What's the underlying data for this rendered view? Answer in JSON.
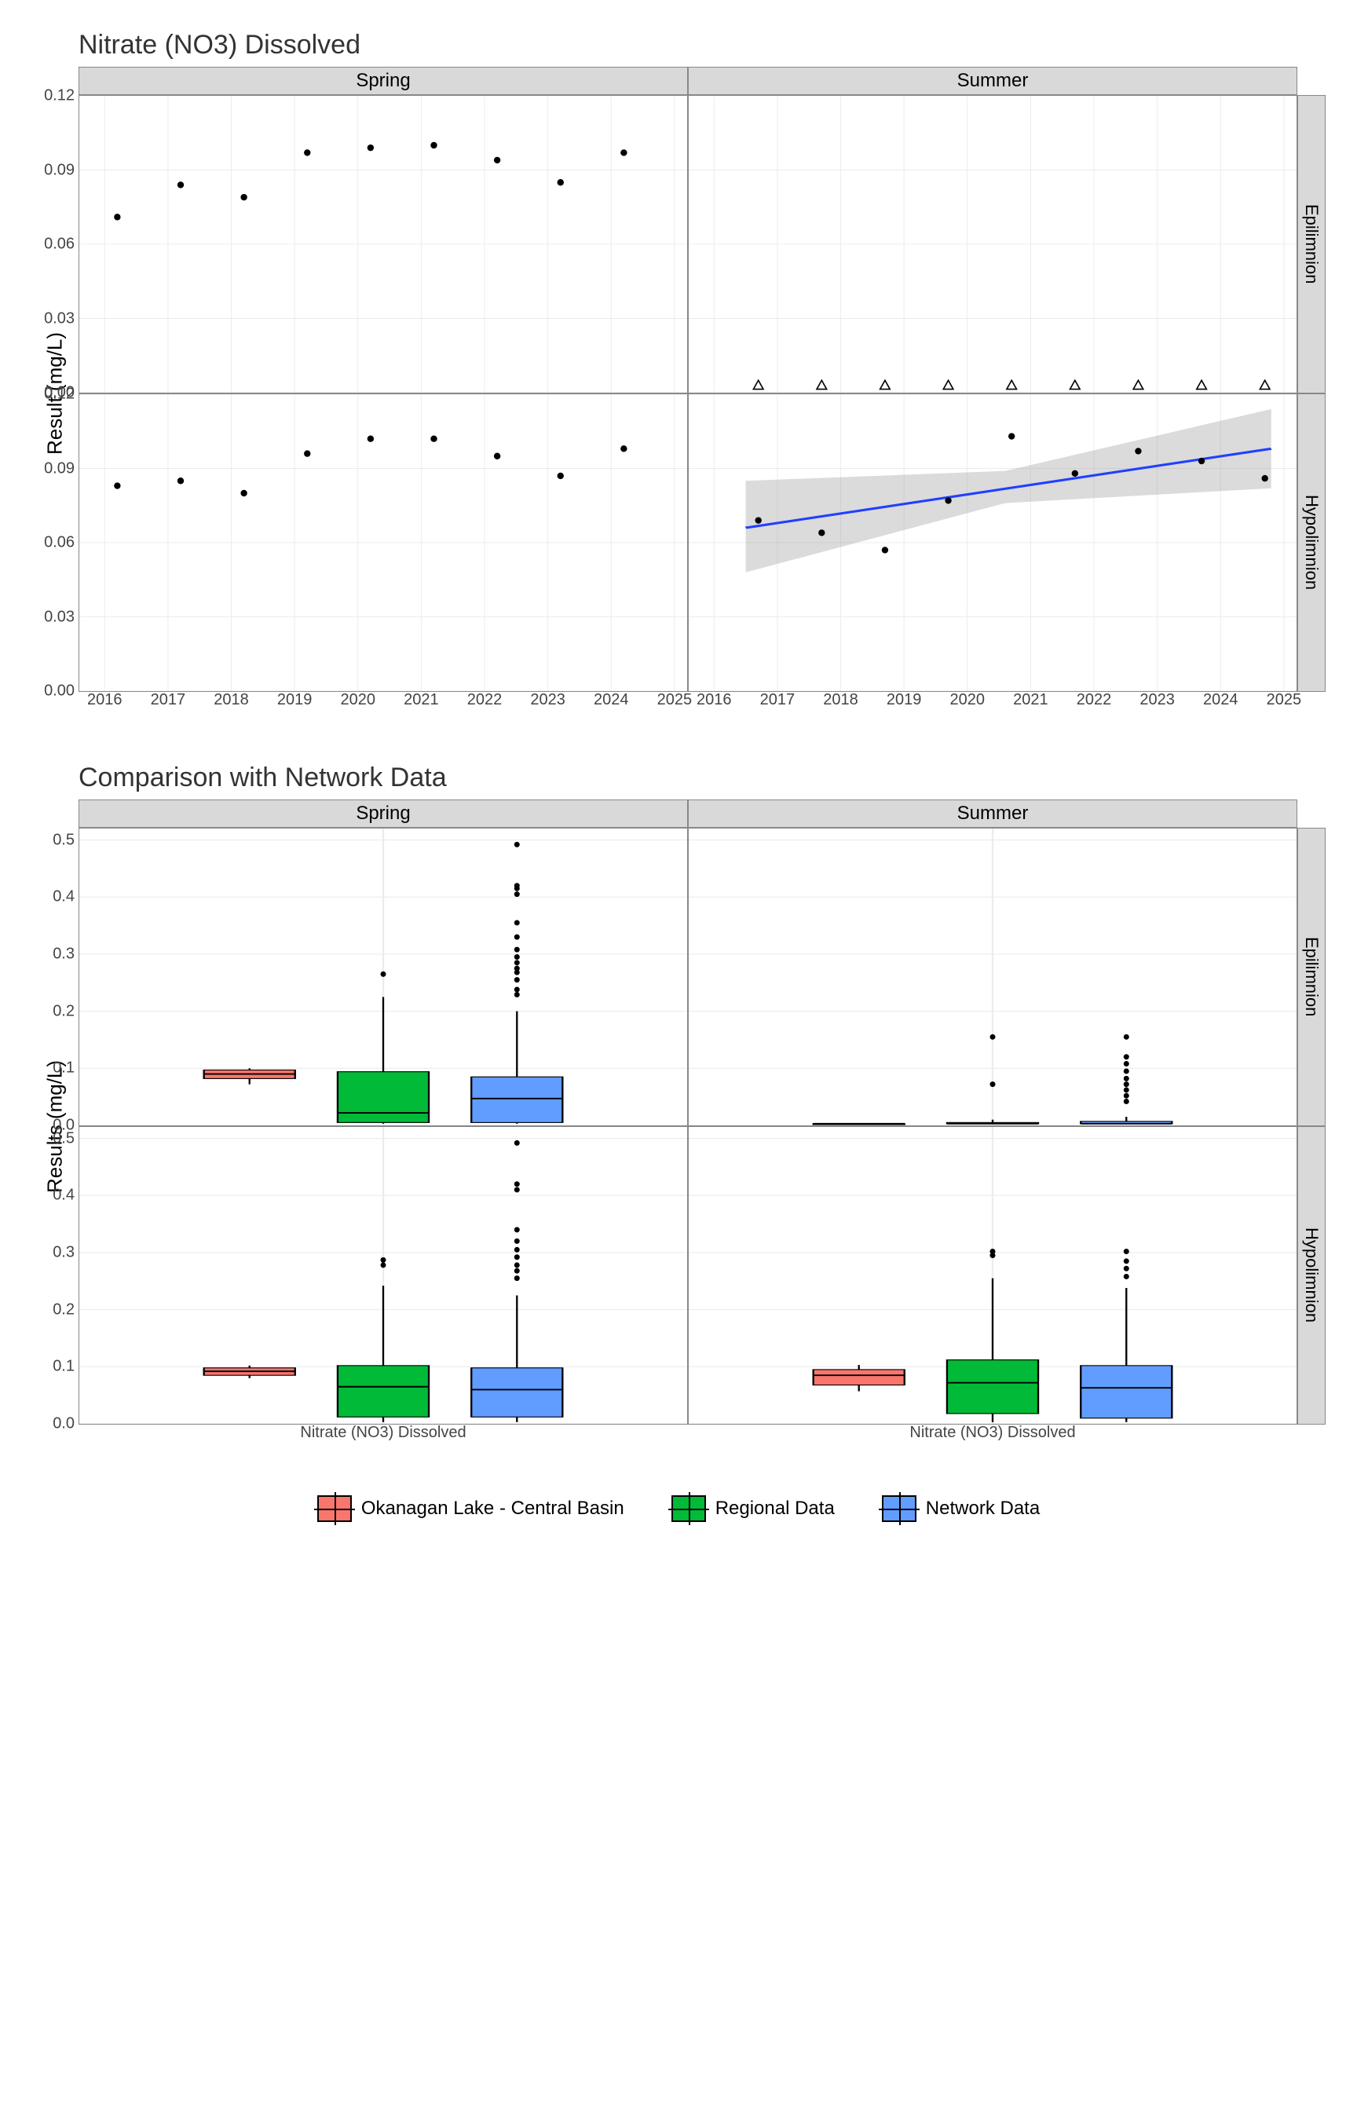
{
  "chart1": {
    "title": "Nitrate (NO3) Dissolved",
    "ylabel": "Result (mg/L)",
    "facets": {
      "columns": [
        "Spring",
        "Summer"
      ],
      "rows": [
        "Epilimnion",
        "Hypolimnion"
      ]
    },
    "x_range": [
      2015.6,
      2025.2
    ],
    "y_range": [
      0.0,
      0.12
    ],
    "x_ticks": [
      2016,
      2017,
      2018,
      2019,
      2020,
      2021,
      2022,
      2023,
      2024,
      2025
    ],
    "y_ticks": [
      0.0,
      0.03,
      0.06,
      0.09,
      0.12
    ]
  },
  "chart2": {
    "title": "Comparison with Network Data",
    "ylabel": "Results (mg/L)",
    "facets": {
      "columns": [
        "Spring",
        "Summer"
      ],
      "rows": [
        "Epilimnion",
        "Hypolimnion"
      ]
    },
    "xlabel": "Nitrate (NO3) Dissolved",
    "y_range": [
      0.0,
      0.52
    ],
    "y_ticks": [
      0.0,
      0.1,
      0.2,
      0.3,
      0.4,
      0.5
    ]
  },
  "legend": {
    "items": [
      {
        "label": "Okanagan Lake - Central Basin",
        "color": "#F8766D"
      },
      {
        "label": "Regional Data",
        "color": "#00BA38"
      },
      {
        "label": "Network Data",
        "color": "#619CFF"
      }
    ]
  },
  "chart_data": [
    {
      "type": "scatter",
      "title": "Nitrate (NO3) Dissolved",
      "ylabel": "Result (mg/L)",
      "ylim": [
        0.0,
        0.12
      ],
      "x_ticks": [
        2016,
        2017,
        2018,
        2019,
        2020,
        2021,
        2022,
        2023,
        2024,
        2025
      ],
      "panels": {
        "Spring_Epilimnion": {
          "points": [
            {
              "x": 2016.2,
              "y": 0.071
            },
            {
              "x": 2017.2,
              "y": 0.084
            },
            {
              "x": 2018.2,
              "y": 0.079
            },
            {
              "x": 2019.2,
              "y": 0.097
            },
            {
              "x": 2020.2,
              "y": 0.099
            },
            {
              "x": 2021.2,
              "y": 0.1
            },
            {
              "x": 2022.2,
              "y": 0.094
            },
            {
              "x": 2023.2,
              "y": 0.085
            },
            {
              "x": 2024.2,
              "y": 0.097
            }
          ]
        },
        "Summer_Epilimnion": {
          "below_detection_x": [
            2016.7,
            2017.7,
            2018.7,
            2019.7,
            2020.7,
            2021.7,
            2022.7,
            2023.7,
            2024.7
          ],
          "below_detection_y": 0.003
        },
        "Spring_Hypolimnion": {
          "points": [
            {
              "x": 2016.2,
              "y": 0.083
            },
            {
              "x": 2017.2,
              "y": 0.085
            },
            {
              "x": 2018.2,
              "y": 0.08
            },
            {
              "x": 2019.2,
              "y": 0.096
            },
            {
              "x": 2020.2,
              "y": 0.102
            },
            {
              "x": 2021.2,
              "y": 0.102
            },
            {
              "x": 2022.2,
              "y": 0.095
            },
            {
              "x": 2023.2,
              "y": 0.087
            },
            {
              "x": 2024.2,
              "y": 0.098
            }
          ]
        },
        "Summer_Hypolimnion": {
          "points": [
            {
              "x": 2016.7,
              "y": 0.069
            },
            {
              "x": 2017.7,
              "y": 0.064
            },
            {
              "x": 2018.7,
              "y": 0.057
            },
            {
              "x": 2019.7,
              "y": 0.077
            },
            {
              "x": 2020.7,
              "y": 0.103
            },
            {
              "x": 2021.7,
              "y": 0.088
            },
            {
              "x": 2022.7,
              "y": 0.097
            },
            {
              "x": 2023.7,
              "y": 0.093
            },
            {
              "x": 2024.7,
              "y": 0.086
            }
          ],
          "trend_line": {
            "x0": 2016.5,
            "y0": 0.066,
            "x1": 2024.8,
            "y1": 0.098
          },
          "ci_polygon": [
            {
              "x": 2016.5,
              "y": 0.048
            },
            {
              "x": 2020.6,
              "y": 0.076
            },
            {
              "x": 2024.8,
              "y": 0.082
            },
            {
              "x": 2024.8,
              "y": 0.114
            },
            {
              "x": 2020.6,
              "y": 0.089
            },
            {
              "x": 2016.5,
              "y": 0.085
            }
          ]
        }
      }
    },
    {
      "type": "boxplot",
      "title": "Comparison with Network Data",
      "ylabel": "Results (mg/L)",
      "xlabel": "Nitrate (NO3) Dissolved",
      "ylim": [
        0.0,
        0.52
      ],
      "categories": [
        "Okanagan Lake - Central Basin",
        "Regional Data",
        "Network Data"
      ],
      "colors": [
        "#F8766D",
        "#00BA38",
        "#619CFF"
      ],
      "panels": {
        "Spring_Epilimnion": {
          "boxes": [
            {
              "min": 0.072,
              "q1": 0.082,
              "med": 0.09,
              "q3": 0.097,
              "max": 0.1,
              "outliers": []
            },
            {
              "min": 0.003,
              "q1": 0.005,
              "med": 0.022,
              "q3": 0.094,
              "max": 0.225,
              "outliers": [
                0.265
              ]
            },
            {
              "min": 0.003,
              "q1": 0.005,
              "med": 0.047,
              "q3": 0.085,
              "max": 0.2,
              "outliers": [
                0.229,
                0.238,
                0.255,
                0.268,
                0.275,
                0.285,
                0.295,
                0.308,
                0.33,
                0.355,
                0.405,
                0.415,
                0.42,
                0.492
              ]
            }
          ]
        },
        "Summer_Epilimnion": {
          "boxes": [
            {
              "min": 0.003,
              "q1": 0.003,
              "med": 0.003,
              "q3": 0.003,
              "max": 0.003,
              "outliers": []
            },
            {
              "min": 0.003,
              "q1": 0.003,
              "med": 0.003,
              "q3": 0.005,
              "max": 0.01,
              "outliers": [
                0.072,
                0.155
              ]
            },
            {
              "min": 0.003,
              "q1": 0.003,
              "med": 0.003,
              "q3": 0.007,
              "max": 0.015,
              "outliers": [
                0.042,
                0.052,
                0.062,
                0.072,
                0.082,
                0.095,
                0.108,
                0.12,
                0.155
              ]
            }
          ]
        },
        "Spring_Hypolimnion": {
          "boxes": [
            {
              "min": 0.08,
              "q1": 0.085,
              "med": 0.092,
              "q3": 0.098,
              "max": 0.102,
              "outliers": []
            },
            {
              "min": 0.003,
              "q1": 0.012,
              "med": 0.065,
              "q3": 0.102,
              "max": 0.242,
              "outliers": [
                0.278,
                0.287
              ]
            },
            {
              "min": 0.003,
              "q1": 0.012,
              "med": 0.06,
              "q3": 0.098,
              "max": 0.225,
              "outliers": [
                0.255,
                0.268,
                0.278,
                0.292,
                0.305,
                0.32,
                0.34,
                0.41,
                0.42,
                0.492
              ]
            }
          ]
        },
        "Summer_Hypolimnion": {
          "boxes": [
            {
              "min": 0.057,
              "q1": 0.068,
              "med": 0.085,
              "q3": 0.095,
              "max": 0.103,
              "outliers": []
            },
            {
              "min": 0.003,
              "q1": 0.018,
              "med": 0.072,
              "q3": 0.112,
              "max": 0.255,
              "outliers": [
                0.295,
                0.302
              ]
            },
            {
              "min": 0.003,
              "q1": 0.01,
              "med": 0.063,
              "q3": 0.102,
              "max": 0.238,
              "outliers": [
                0.258,
                0.272,
                0.285,
                0.302
              ]
            }
          ]
        }
      }
    }
  ]
}
